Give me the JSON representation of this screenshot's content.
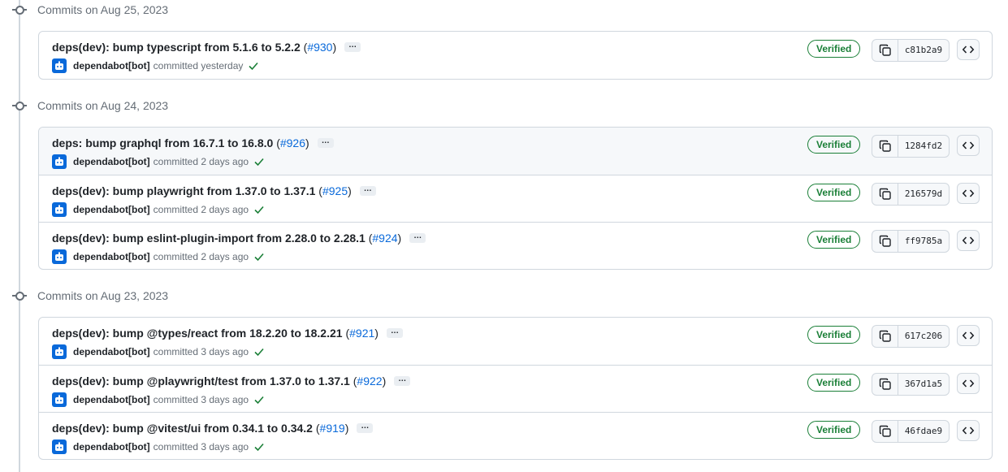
{
  "groups": [
    {
      "date_label": "Commits on Aug 25, 2023",
      "commits": [
        {
          "title": "deps(dev): bump typescript from 5.1.6 to 5.2.2",
          "pr": "#930",
          "author": "dependabot[bot]",
          "when": "committed yesterday",
          "badge": "Verified",
          "sha": "c81b2a9"
        }
      ]
    },
    {
      "date_label": "Commits on Aug 24, 2023",
      "commits": [
        {
          "title": "deps: bump graphql from 16.7.1 to 16.8.0",
          "pr": "#926",
          "author": "dependabot[bot]",
          "when": "committed 2 days ago",
          "badge": "Verified",
          "sha": "1284fd2"
        },
        {
          "title": "deps(dev): bump playwright from 1.37.0 to 1.37.1",
          "pr": "#925",
          "author": "dependabot[bot]",
          "when": "committed 2 days ago",
          "badge": "Verified",
          "sha": "216579d"
        },
        {
          "title": "deps(dev): bump eslint-plugin-import from 2.28.0 to 2.28.1",
          "pr": "#924",
          "author": "dependabot[bot]",
          "when": "committed 2 days ago",
          "badge": "Verified",
          "sha": "ff9785a"
        }
      ]
    },
    {
      "date_label": "Commits on Aug 23, 2023",
      "commits": [
        {
          "title": "deps(dev): bump @types/react from 18.2.20 to 18.2.21",
          "pr": "#921",
          "author": "dependabot[bot]",
          "when": "committed 3 days ago",
          "badge": "Verified",
          "sha": "617c206"
        },
        {
          "title": "deps(dev): bump @playwright/test from 1.37.0 to 1.37.1",
          "pr": "#922",
          "author": "dependabot[bot]",
          "when": "committed 3 days ago",
          "badge": "Verified",
          "sha": "367d1a5"
        },
        {
          "title": "deps(dev): bump @vitest/ui from 0.34.1 to 0.34.2",
          "pr": "#919",
          "author": "dependabot[bot]",
          "when": "committed 3 days ago",
          "badge": "Verified",
          "sha": "46fdae9"
        }
      ]
    }
  ],
  "ellipsis_label": "…",
  "colors": {
    "link": "#0969da",
    "verified": "#1a7f37",
    "avatar": "#0969da",
    "border": "#d0d7de"
  },
  "icons": {
    "commit": "git-commit-icon",
    "copy": "copy-icon",
    "browse": "code-icon",
    "check": "check-icon",
    "avatar": "dependabot-icon"
  }
}
